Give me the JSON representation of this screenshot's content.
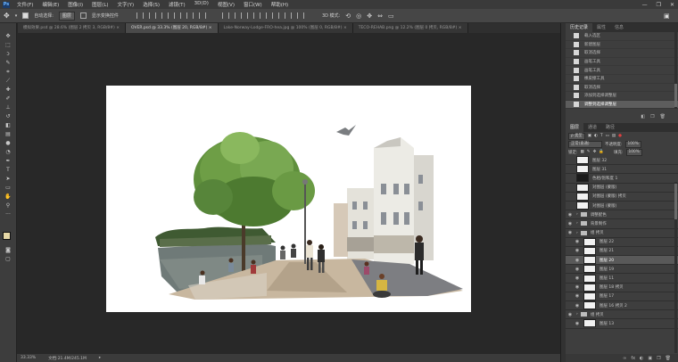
{
  "menubar": {
    "logo": "Ps",
    "items": [
      "文件(F)",
      "编辑(E)",
      "图像(I)",
      "图层(L)",
      "文字(Y)",
      "选择(S)",
      "滤镜(T)",
      "3D(D)",
      "视图(V)",
      "窗口(W)",
      "帮助(H)"
    ],
    "window_controls": [
      "—",
      "❐",
      "✕"
    ]
  },
  "options": {
    "auto_select_label": "自动选择:",
    "auto_select_value": "图层",
    "transform_label": "显示变换控件",
    "mode_3d_label": "3D 模式:"
  },
  "tabs": [
    {
      "label": "模拟效果.psd @ 28.6% (图层 2 拷贝 3, RGB/8#)",
      "active": false
    },
    {
      "label": "OVER.psd @ 33.3% (图层 20, RGB/8#)",
      "active": true
    },
    {
      "label": "Lake-Norway-Lodge-FRO-hea.jpg @ 100% (图层 0, RGB/8#)",
      "active": false
    },
    {
      "label": "TECO-REHAB.png @ 12.2% (图层 0 拷贝, RGB/8#)",
      "active": false
    }
  ],
  "statusbar": {
    "zoom": "33.33%",
    "doc_info": "文档:21.4M/245.1M"
  },
  "history_panel": {
    "tabs": [
      "历史记录",
      "属性",
      "信息"
    ],
    "items": [
      {
        "label": "载入选区",
        "selected": false
      },
      {
        "label": "新建图层",
        "selected": false
      },
      {
        "label": "取消选择",
        "selected": false
      },
      {
        "label": "画笔工具",
        "selected": false
      },
      {
        "label": "画笔工具",
        "selected": false
      },
      {
        "label": "橡皮擦工具",
        "selected": false
      },
      {
        "label": "取消选择",
        "selected": false
      },
      {
        "label": "添加到选择调整层",
        "selected": false
      },
      {
        "label": "调整到选择调整层",
        "selected": true
      }
    ]
  },
  "layers_panel": {
    "tabs": [
      "图层",
      "通道",
      "路径"
    ],
    "kind_label": "ρ 类型",
    "blend_mode": "正常(直通)",
    "opacity_label": "不透明度:",
    "opacity_value": "100%",
    "lock_label": "锁定:",
    "fill_label": "填充:",
    "fill_value": "100%",
    "layers": [
      {
        "label": "图层 32",
        "type": "layer",
        "visible": false,
        "selected": false
      },
      {
        "label": "图层 31",
        "type": "layer",
        "visible": false,
        "selected": false
      },
      {
        "label": "色相/饱和度 1",
        "type": "adjust",
        "visible": false,
        "selected": false
      },
      {
        "label": "对图层 (蒙版)",
        "type": "layer",
        "visible": false,
        "selected": false
      },
      {
        "label": "对图层 (蒙版) 拷贝",
        "type": "layer",
        "visible": false,
        "selected": false
      },
      {
        "label": "对图层 (蒙版)",
        "type": "layer",
        "visible": false,
        "selected": false
      },
      {
        "label": "调整配色",
        "type": "folder",
        "visible": true,
        "selected": false
      },
      {
        "label": "背景制作",
        "type": "folder",
        "visible": true,
        "selected": false
      },
      {
        "label": "组 拷贝",
        "type": "folder",
        "visible": true,
        "selected": false
      },
      {
        "label": "图层 22",
        "type": "layer",
        "visible": true,
        "selected": false
      },
      {
        "label": "图层 21",
        "type": "layer",
        "visible": true,
        "selected": false
      },
      {
        "label": "图层 20",
        "type": "layer",
        "visible": true,
        "selected": true
      },
      {
        "label": "图层 19",
        "type": "layer",
        "visible": true,
        "selected": false
      },
      {
        "label": "图层 11",
        "type": "layer",
        "visible": true,
        "selected": false
      },
      {
        "label": "图层 18 拷贝",
        "type": "layer",
        "visible": true,
        "selected": false
      },
      {
        "label": "图层 17",
        "type": "layer",
        "visible": true,
        "selected": false
      },
      {
        "label": "图层 16 拷贝 2",
        "type": "layer",
        "visible": true,
        "selected": false
      },
      {
        "label": "组 拷贝",
        "type": "folder",
        "visible": true,
        "selected": false
      },
      {
        "label": "图层 13",
        "type": "layer",
        "visible": true,
        "selected": false
      }
    ],
    "bottom_icons": [
      "∞",
      "fx",
      "◐",
      "▣",
      "❐",
      "🗑"
    ]
  },
  "colors": {
    "accent_selected": "#595959",
    "foreground_swatch": "#e6d8a6",
    "background_swatch": "#ffffff"
  }
}
